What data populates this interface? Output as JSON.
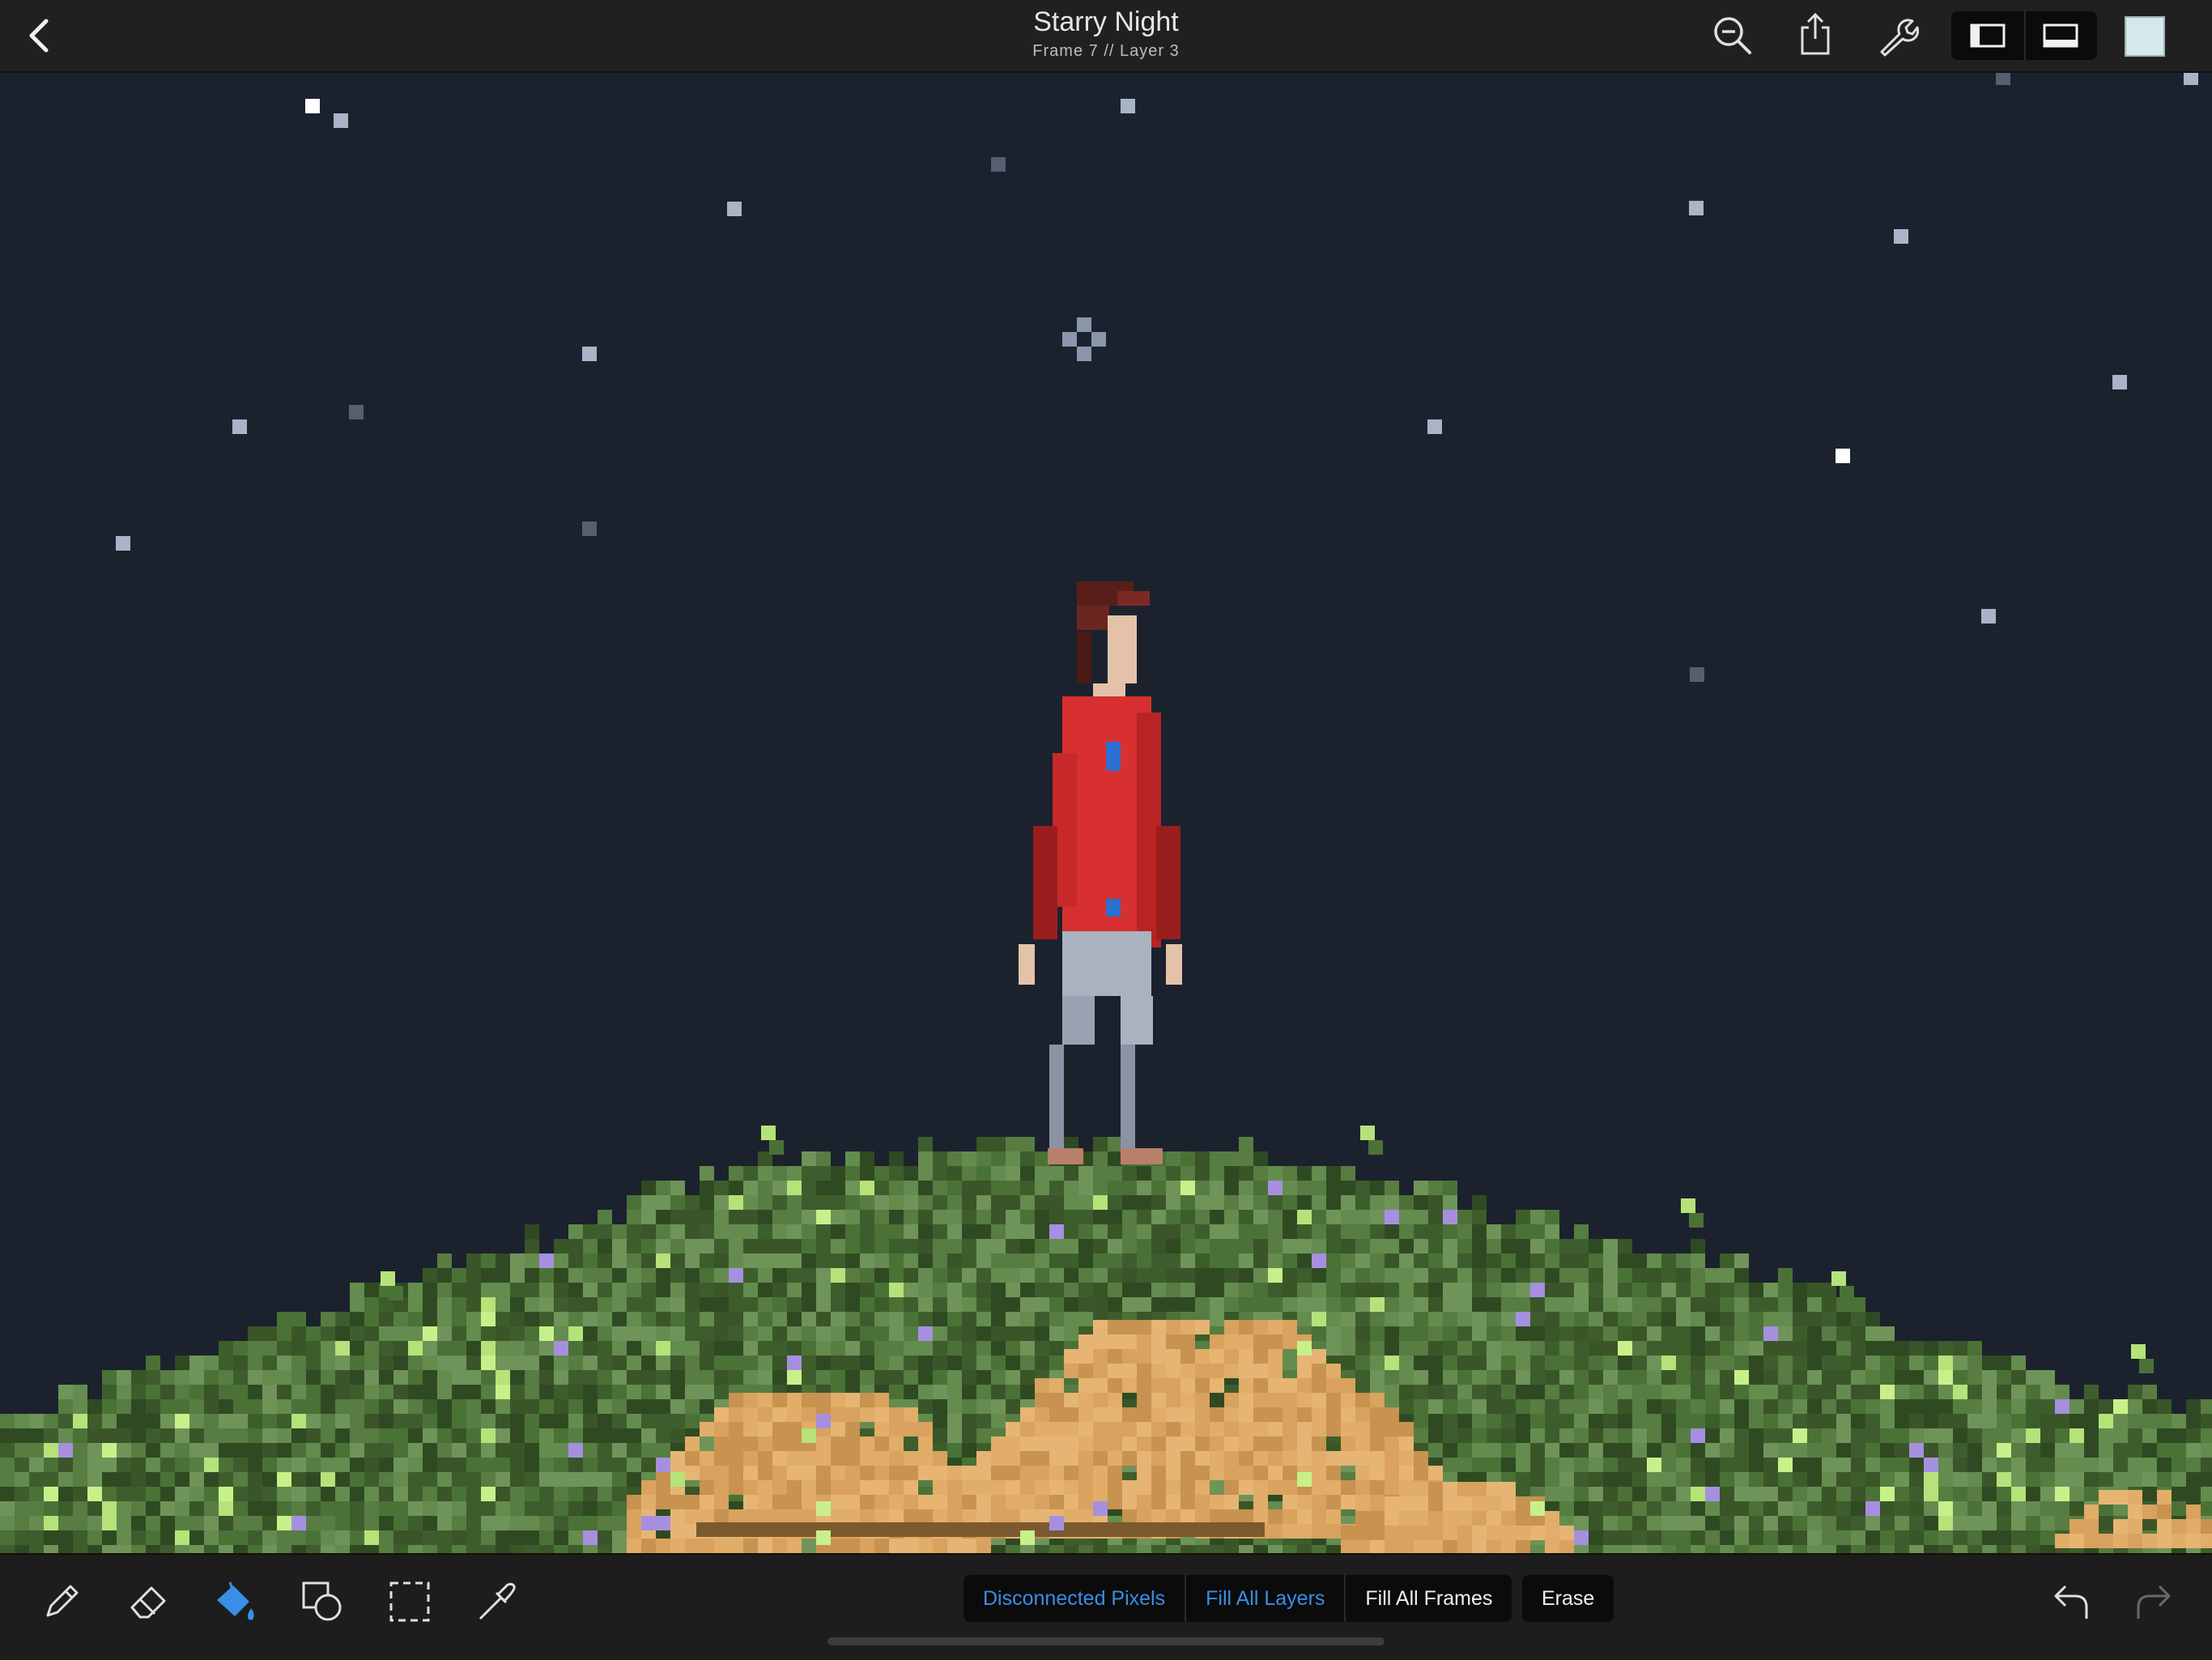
{
  "header": {
    "title": "Starry Night",
    "subtitle": "Frame 7 // Layer 3",
    "current_color": "#d5e8ea"
  },
  "toolbar_icons": [
    "back-icon",
    "zoom-out-icon",
    "share-icon",
    "wrench-icon",
    "layout-left-panel-icon",
    "layout-bottom-panel-icon"
  ],
  "tools": [
    {
      "name": "pencil-icon",
      "active": false
    },
    {
      "name": "eraser-icon",
      "active": false
    },
    {
      "name": "paint-bucket-icon",
      "active": true
    },
    {
      "name": "shapes-icon",
      "active": false
    },
    {
      "name": "selection-icon",
      "active": false
    },
    {
      "name": "eyedropper-icon",
      "active": false
    }
  ],
  "fill_options": {
    "disconnected_pixels": "Disconnected Pixels",
    "fill_all_layers": "Fill All Layers",
    "fill_all_frames": "Fill All Frames",
    "erase": "Erase"
  },
  "colors": {
    "sky": "#1b222e",
    "accent": "#3a8ee6"
  }
}
